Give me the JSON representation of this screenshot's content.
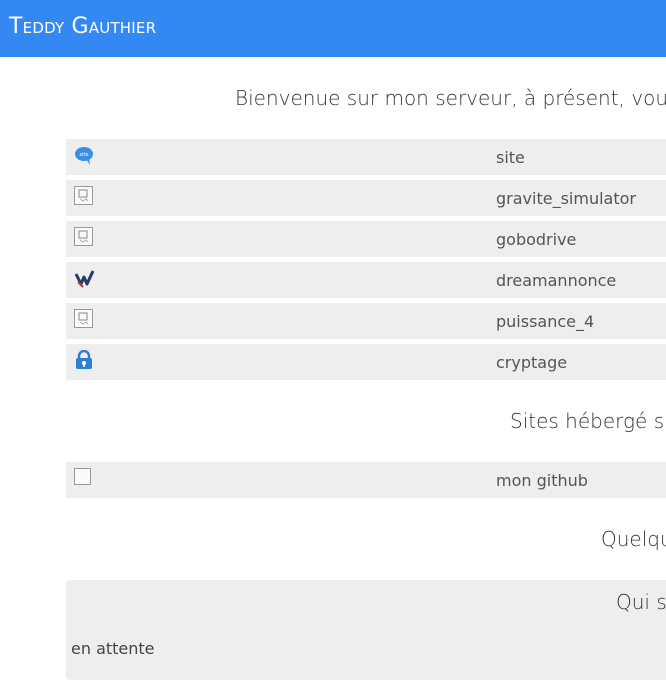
{
  "header": {
    "title": "Teddy Gauthier"
  },
  "intro": "Bienvenue sur mon serveur, à présent, vous",
  "projects": [
    {
      "label": "site",
      "icon": "speech-bubble-icon"
    },
    {
      "label": "gravite_simulator",
      "icon": "broken-image-icon"
    },
    {
      "label": "gobodrive",
      "icon": "broken-image-icon"
    },
    {
      "label": "dreamannonce",
      "icon": "dreamannonce-logo-icon"
    },
    {
      "label": "puissance_4",
      "icon": "broken-image-icon"
    },
    {
      "label": "cryptage",
      "icon": "padlock-icon"
    }
  ],
  "hosted_section": {
    "title": "Sites hébergé su"
  },
  "hosted": [
    {
      "label": "mon github",
      "icon": "broken-image-icon"
    }
  ],
  "misc_section": {
    "title": "Quelqu"
  },
  "panel": {
    "title": "Qui s",
    "status": "en attente"
  },
  "colors": {
    "header_bg": "#3388f3",
    "row_bg": "#eeeeee",
    "accent": "#2f7fd0"
  }
}
